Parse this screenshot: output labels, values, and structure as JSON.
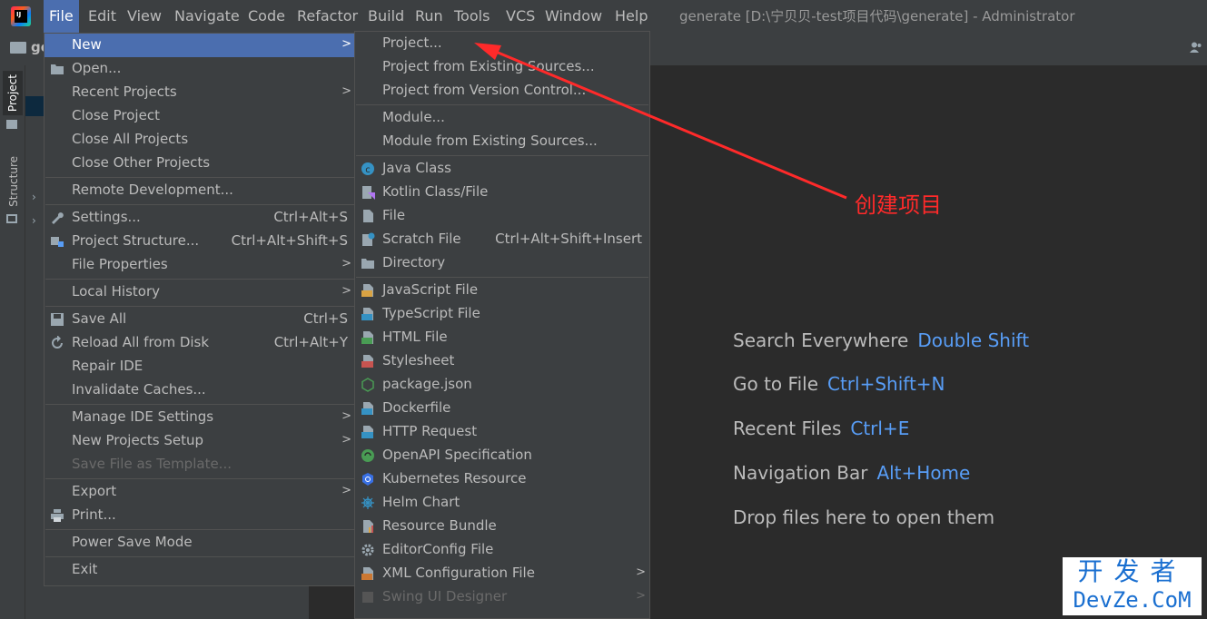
{
  "menubar": {
    "items": [
      "File",
      "Edit",
      "View",
      "Navigate",
      "Code",
      "Refactor",
      "Build",
      "Run",
      "Tools",
      "VCS",
      "Window",
      "Help"
    ],
    "window_title": "generate [D:\\宁贝贝-test项目代码\\generate] - Administrator"
  },
  "toolbar": {
    "project_name": "ge"
  },
  "side_tabs": {
    "project": "Project",
    "structure": "Structure"
  },
  "file_menu": {
    "new": "New",
    "open": "Open...",
    "recent_projects": "Recent Projects",
    "close_project": "Close Project",
    "close_all_projects": "Close All Projects",
    "close_other_projects": "Close Other Projects",
    "remote_development": "Remote Development...",
    "settings": "Settings...",
    "settings_sc": "Ctrl+Alt+S",
    "project_structure": "Project Structure...",
    "project_structure_sc": "Ctrl+Alt+Shift+S",
    "file_properties": "File Properties",
    "local_history": "Local History",
    "save_all": "Save All",
    "save_all_sc": "Ctrl+S",
    "reload_all": "Reload All from Disk",
    "reload_all_sc": "Ctrl+Alt+Y",
    "repair_ide": "Repair IDE",
    "invalidate_caches": "Invalidate Caches...",
    "manage_ide_settings": "Manage IDE Settings",
    "new_projects_setup": "New Projects Setup",
    "save_as_template": "Save File as Template...",
    "export": "Export",
    "print": "Print...",
    "power_save": "Power Save Mode",
    "exit": "Exit"
  },
  "new_menu": {
    "project": "Project...",
    "project_existing": "Project from Existing Sources...",
    "project_vcs": "Project from Version Control...",
    "module": "Module...",
    "module_existing": "Module from Existing Sources...",
    "java_class": "Java Class",
    "kotlin": "Kotlin Class/File",
    "file": "File",
    "scratch": "Scratch File",
    "scratch_sc": "Ctrl+Alt+Shift+Insert",
    "directory": "Directory",
    "javascript": "JavaScript File",
    "typescript": "TypeScript File",
    "html": "HTML File",
    "stylesheet": "Stylesheet",
    "package_json": "package.json",
    "dockerfile": "Dockerfile",
    "http_request": "HTTP Request",
    "openapi": "OpenAPI Specification",
    "kubernetes": "Kubernetes Resource",
    "helm": "Helm Chart",
    "resource_bundle": "Resource Bundle",
    "editorconfig": "EditorConfig File",
    "xml_config": "XML Configuration File",
    "swing": "Swing UI Designer"
  },
  "editor_hints": {
    "search_label": "Search Everywhere",
    "search_key": "Double Shift",
    "goto_label": "Go to File",
    "goto_key": "Ctrl+Shift+N",
    "recent_label": "Recent Files",
    "recent_key": "Ctrl+E",
    "nav_label": "Navigation Bar",
    "nav_key": "Alt+Home",
    "drop": "Drop files here to open them"
  },
  "annotation": {
    "text": "创建项目",
    "color": "#ff2a2a"
  },
  "watermark": {
    "top": "开发者",
    "bottom": "DevZe.CoM"
  },
  "colors": {
    "selection": "#4b6eaf",
    "menu_bg": "#3c3f41",
    "link_key": "#589df6"
  }
}
